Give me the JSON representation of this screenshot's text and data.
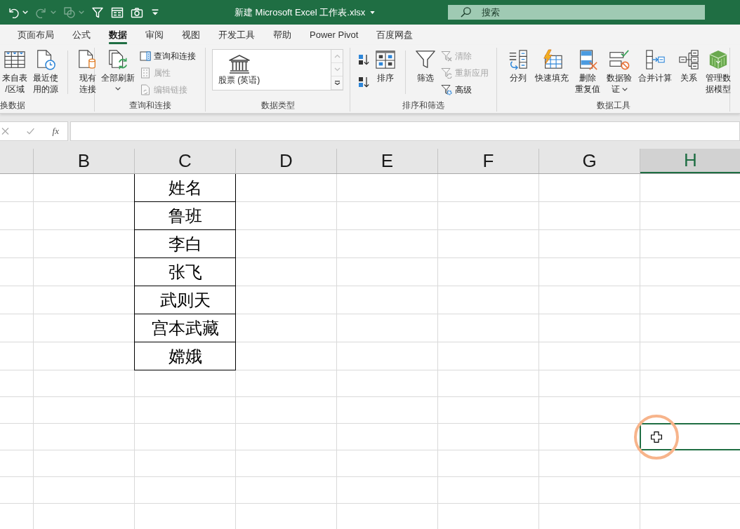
{
  "title_bar": {
    "quick_access": [
      {
        "kind": "undo",
        "disabled": false,
        "menu": true
      },
      {
        "kind": "redo",
        "disabled": true,
        "menu": true
      },
      {
        "kind": "shapes",
        "disabled": true,
        "menu": true
      },
      {
        "kind": "filter",
        "disabled": false,
        "menu": false
      },
      {
        "kind": "form",
        "disabled": false,
        "menu": false
      },
      {
        "kind": "camera",
        "disabled": false,
        "menu": false
      },
      {
        "kind": "customize",
        "disabled": false,
        "menu": false
      }
    ],
    "title": "新建 Microsoft Excel 工作表.xlsx",
    "title_menu": true,
    "search": {
      "placeholder": "搜索"
    }
  },
  "ribbon_tabs": [
    {
      "label": "页面布局",
      "selected": false
    },
    {
      "label": "公式",
      "selected": false
    },
    {
      "label": "数据",
      "selected": true
    },
    {
      "label": "审阅",
      "selected": false
    },
    {
      "label": "视图",
      "selected": false
    },
    {
      "label": "开发工具",
      "selected": false
    },
    {
      "label": "帮助",
      "selected": false
    },
    {
      "label": "Power Pivot",
      "selected": false
    },
    {
      "label": "百度网盘",
      "selected": false
    }
  ],
  "ribbon_groups": [
    {
      "label": "换数据",
      "items": [
        {
          "kind": "table",
          "lines": [
            "来自表",
            "/区域"
          ]
        },
        {
          "kind": "recent",
          "lines": [
            "最近使",
            "用的源"
          ]
        },
        {
          "kind": "separator"
        },
        {
          "kind": "connections",
          "lines": [
            "现有",
            "连接"
          ]
        }
      ]
    },
    {
      "label": "查询和连接",
      "items": [
        {
          "kind": "refresh",
          "lines": [
            "全部刷新"
          ],
          "menu": true
        },
        {
          "kind": "stack",
          "buttons": [
            {
              "kind": "queries",
              "label": "查询和连接",
              "disabled": false
            },
            {
              "kind": "properties",
              "label": "属性",
              "disabled": true
            },
            {
              "kind": "links",
              "label": "编辑链接",
              "disabled": true
            }
          ]
        }
      ]
    },
    {
      "label": "数据类型",
      "items": [
        {
          "kind": "gallery",
          "label": "股票 (英语)",
          "scroll": [
            {
              "kind": "up",
              "disabled": true
            },
            {
              "kind": "down",
              "disabled": true
            },
            {
              "kind": "more",
              "disabled": false
            }
          ]
        }
      ]
    },
    {
      "label": "排序和筛选",
      "items": [
        {
          "kind": "stack",
          "buttons": [
            {
              "kind": "sortaz",
              "disabled": false
            },
            {
              "kind": "sortza",
              "disabled": false
            }
          ]
        },
        {
          "kind": "sort",
          "lines": [
            "排序"
          ]
        },
        {
          "kind": "separator"
        },
        {
          "kind": "filter",
          "lines": [
            "筛选"
          ]
        },
        {
          "kind": "stack",
          "buttons": [
            {
              "kind": "clear",
              "label": "清除",
              "disabled": true
            },
            {
              "kind": "reapply",
              "label": "重新应用",
              "disabled": true
            },
            {
              "kind": "advanced",
              "label": "高级",
              "disabled": false
            }
          ]
        }
      ]
    },
    {
      "label": "数据工具",
      "items": [
        {
          "kind": "split",
          "lines": [
            "分列"
          ]
        },
        {
          "kind": "flashfill",
          "lines": [
            "快速填充"
          ]
        },
        {
          "kind": "dedupe",
          "lines": [
            "删除",
            "重复值"
          ]
        },
        {
          "kind": "validate",
          "lines": [
            "数据验",
            "证"
          ],
          "menu": true
        },
        {
          "kind": "consolidate",
          "lines": [
            "合并计算"
          ]
        },
        {
          "kind": "relations",
          "lines": [
            "关系"
          ]
        },
        {
          "kind": "datamodel",
          "lines": [
            "管理数",
            "据模型"
          ]
        }
      ]
    }
  ],
  "formula_bar": {
    "function_label": "fx"
  },
  "sheet": {
    "columns": [
      {
        "label": "B",
        "selected": false
      },
      {
        "label": "C",
        "selected": false
      },
      {
        "label": "D",
        "selected": false
      },
      {
        "label": "E",
        "selected": false
      },
      {
        "label": "F",
        "selected": false
      },
      {
        "label": "G",
        "selected": false
      },
      {
        "label": "H",
        "selected": true
      }
    ],
    "rows": [
      {
        "kind": "data",
        "column_c": "姓名"
      },
      {
        "kind": "data",
        "column_c": "鲁班"
      },
      {
        "kind": "data",
        "column_c": "李白"
      },
      {
        "kind": "data",
        "column_c": "张飞"
      },
      {
        "kind": "data",
        "column_c": "武则天"
      },
      {
        "kind": "data",
        "column_c": "宫本武藏"
      },
      {
        "kind": "data",
        "column_c": "嫦娥"
      },
      {
        "kind": "empty"
      },
      {
        "kind": "empty"
      },
      {
        "kind": "active"
      },
      {
        "kind": "empty"
      },
      {
        "kind": "empty"
      },
      {
        "kind": "empty"
      }
    ]
  }
}
